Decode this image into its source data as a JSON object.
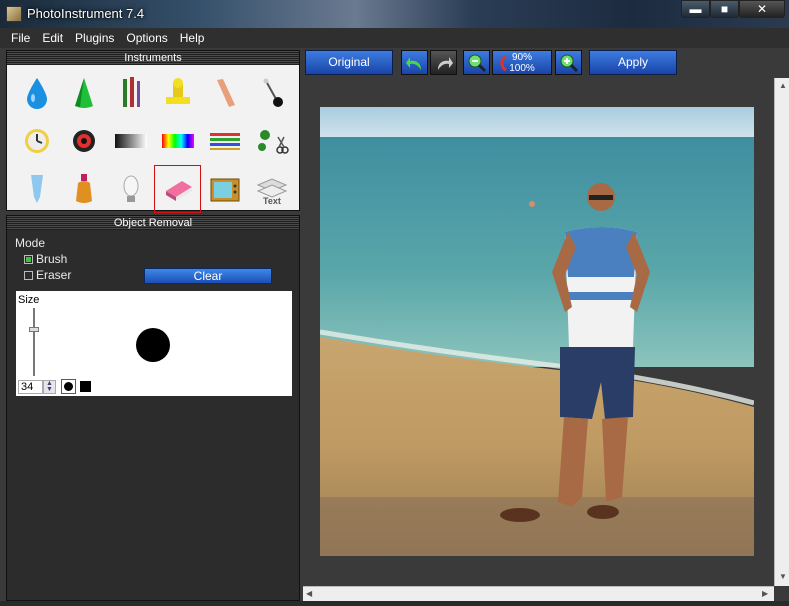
{
  "window": {
    "title": "PhotoInstrument 7.4",
    "minimize": "▬",
    "maximize": "■",
    "close": "✕"
  },
  "menu": [
    "File",
    "Edit",
    "Plugins",
    "Options",
    "Help"
  ],
  "instruments_panel": {
    "title": "Instruments",
    "tools": [
      {
        "name": "drop-icon",
        "selected": false
      },
      {
        "name": "cone-icon",
        "selected": false
      },
      {
        "name": "brushes-icon",
        "selected": false
      },
      {
        "name": "stamp-icon",
        "selected": false
      },
      {
        "name": "finger-smudge-icon",
        "selected": false
      },
      {
        "name": "pin-icon",
        "selected": false
      },
      {
        "name": "clock-icon",
        "selected": false
      },
      {
        "name": "eye-icon",
        "selected": false
      },
      {
        "name": "gradient-icon",
        "selected": false
      },
      {
        "name": "rainbow-icon",
        "selected": false
      },
      {
        "name": "color-lines-icon",
        "selected": false
      },
      {
        "name": "clone-scissors-icon",
        "selected": false
      },
      {
        "name": "tube-icon",
        "selected": false
      },
      {
        "name": "bottle-icon",
        "selected": false
      },
      {
        "name": "lamp-icon",
        "selected": false
      },
      {
        "name": "eraser-icon",
        "selected": true
      },
      {
        "name": "retro-tv-icon",
        "selected": false
      },
      {
        "name": "text-icon",
        "selected": false
      }
    ],
    "text_tool_label": "Text"
  },
  "object_removal": {
    "title": "Object Removal",
    "mode_label": "Mode",
    "brush_label": "Brush",
    "brush_checked": true,
    "eraser_label": "Eraser",
    "eraser_checked": false,
    "clear_label": "Clear",
    "size_label": "Size",
    "size_value": "34",
    "brush_shape": "round"
  },
  "toolbar": {
    "original_label": "Original",
    "zoom_top": "90%",
    "zoom_bottom": "100%",
    "apply_label": "Apply",
    "icons": [
      "undo-icon",
      "redo-icon",
      "zoom-out-icon",
      "zoom-toggle-icon",
      "zoom-in-icon"
    ]
  },
  "colors": {
    "accent_blue": "#2a5fcc",
    "panel_dark": "#2c2c2c",
    "selected_border": "#d01010",
    "check_green": "#3ac43a"
  }
}
